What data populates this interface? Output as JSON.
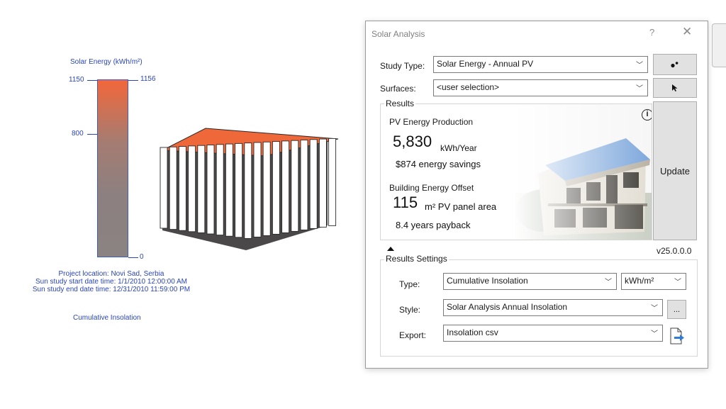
{
  "legend": {
    "title": "Solar Energy (kWh/m²)",
    "max_left": "1150",
    "max_right": "1156",
    "mid_left": "800",
    "min_right": "0",
    "colors": {
      "top": "#f2673a",
      "bottom": "#8b8282"
    }
  },
  "viewport": {
    "location": "Project location: Novi Sad, Serbia",
    "start": "Sun study start date time: 1/1/2010 12:00:00 AM",
    "end": "Sun study end date time: 12/31/2010 11:59:00 PM",
    "caption": "Cumulative Insolation"
  },
  "dialog": {
    "title": "Solar Analysis",
    "help": "?",
    "close": "✕",
    "study_type_label": "Study Type:",
    "study_type_value": "Solar Energy - Annual PV",
    "surfaces_label": "Surfaces:",
    "surfaces_value": "<user selection>",
    "results_label": "Results",
    "pv_label": "PV Energy Production",
    "pv_value": "5,830",
    "pv_unit": "kWh/Year",
    "savings": "$874 energy savings",
    "offset_label": "Building Energy Offset",
    "offset_value": "115",
    "offset_unit": "m² PV panel area",
    "payback": "8.4 years payback",
    "update_label": "Update",
    "version": "v25.0.0.0",
    "settings_label": "Results Settings",
    "type_label": "Type:",
    "type_value": "Cumulative Insolation",
    "unit_value": "kWh/m²",
    "style_label": "Style:",
    "style_value": "Solar Analysis Annual Insolation",
    "style_more": "...",
    "export_label": "Export:",
    "export_value": "Insolation csv"
  }
}
